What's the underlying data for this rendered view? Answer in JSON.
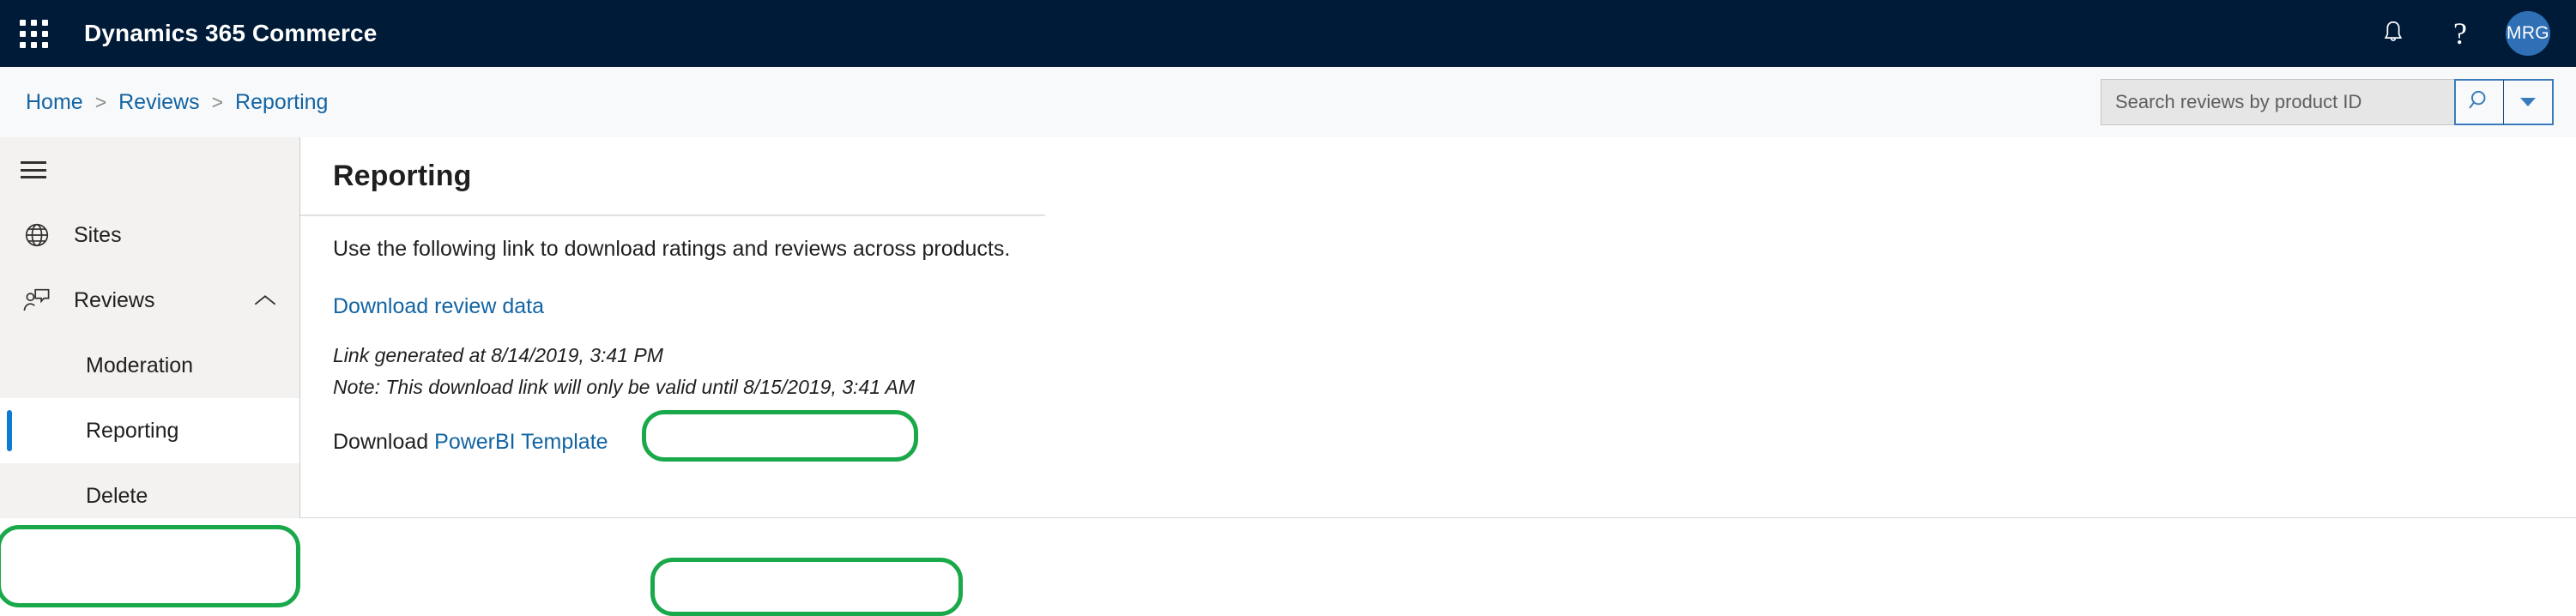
{
  "header": {
    "app_launcher_icon": "waffle-grid-icon",
    "title": "Dynamics 365 Commerce",
    "notifications_icon": "bell-icon",
    "help_icon": "question-mark-icon",
    "help_glyph": "?",
    "avatar_initials": "MRG",
    "background_color": "#001b38",
    "avatar_color": "#2f6fb5"
  },
  "breadcrumb": {
    "items": [
      {
        "label": "Home"
      },
      {
        "label": "Reviews"
      },
      {
        "label": "Reporting"
      }
    ],
    "separator": ">",
    "link_color": "#1264a3"
  },
  "search": {
    "placeholder": "Search reviews by product ID",
    "value": "",
    "search_icon": "magnifier-icon",
    "dropdown_icon": "chevron-down-icon",
    "accent_color": "#3a7cbb"
  },
  "sidebar": {
    "menu_toggle_icon": "hamburger-icon",
    "items": [
      {
        "label": "Sites",
        "icon": "globe-icon",
        "type": "parent",
        "expanded": false
      },
      {
        "label": "Reviews",
        "icon": "person-comment-icon",
        "type": "parent",
        "expanded": true,
        "chevron_icon": "chevron-up-icon"
      }
    ],
    "sub_items": [
      {
        "label": "Moderation",
        "selected": false
      },
      {
        "label": "Reporting",
        "selected": true
      },
      {
        "label": "Delete",
        "selected": false
      }
    ],
    "selected_accent_color": "#0f7ad4"
  },
  "main": {
    "page_title": "Reporting",
    "intro_text": "Use the following link to download ratings and reviews across products.",
    "download_review_link": "Download review data",
    "link_generated_text": "Link generated at 8/14/2019, 3:41 PM",
    "link_expiry_text": "Note: This download link will only be valid until 8/15/2019, 3:41 AM",
    "powerbi_prefix": "Download ",
    "powerbi_link": "PowerBI Template"
  },
  "annotations": {
    "color": "#1aa94a",
    "regions": [
      {
        "name": "sidebar-reporting-highlight"
      },
      {
        "name": "download-review-data-highlight"
      },
      {
        "name": "download-powerbi-template-highlight"
      }
    ]
  }
}
